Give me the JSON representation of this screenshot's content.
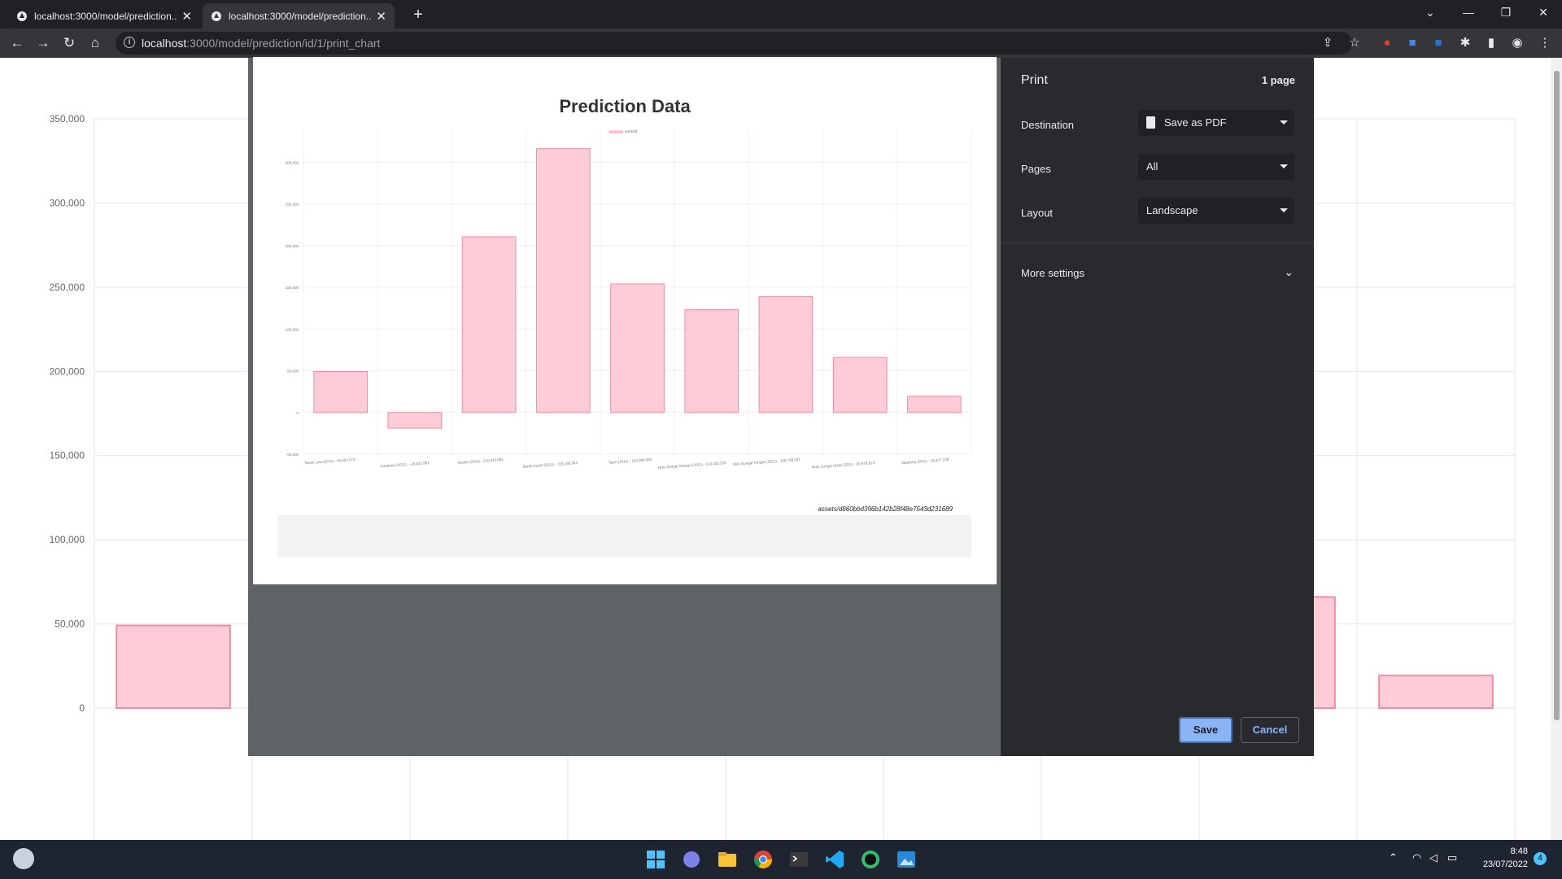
{
  "browser": {
    "tabs": [
      {
        "title": "localhost:3000/model/prediction..."
      },
      {
        "title": "localhost:3000/model/prediction..."
      }
    ],
    "new_tab_label": "+",
    "url_host": "localhost",
    "url_path": ":3000/model/prediction/id/1/print_chart"
  },
  "background_chart": {
    "y_ticks": [
      "350,000",
      "300,000",
      "250,000",
      "200,000",
      "150,000",
      "100,000",
      "50,000",
      "0"
    ]
  },
  "print_preview": {
    "title": "Prediction Data",
    "legend_label": "Result",
    "hash_text": "assets/d860bbd396b142b28f48e7543d231689"
  },
  "chart_data": {
    "type": "bar",
    "title": "Prediction Data",
    "categories": [
      "Tanah Laut (2011) - 49,053.074",
      "Kotabaru (2011) - -18,822.801",
      "Banjar (2011) - 210,613.891",
      "Barito Kuala (2011) - 316,158.844",
      "Tapin (2011) - 154,006.984",
      "Hulu Sungai Selatan (2011) - 123,253.523",
      "Hulu Sungai Tengah (2011) - 138,758.531",
      "Hulu Sungai Utara (2011) - 65,978.914",
      "Tabalong (2011) - 19,427.238"
    ],
    "values": [
      49053.074,
      -18822.801,
      210613.891,
      316158.844,
      154006.984,
      123253.523,
      138758.531,
      65978.914,
      19427.238
    ],
    "series": [
      {
        "name": "Result"
      }
    ],
    "ylim": [
      -50000,
      350000
    ],
    "y_ticks": [
      "350,000",
      "300,000",
      "250,000",
      "200,000",
      "150,000",
      "100,000",
      "50,000",
      "0",
      "-50,000"
    ],
    "legend": "top",
    "grid": true,
    "color": "#ffcdd8",
    "border_color": "#f28ba6"
  },
  "print_panel": {
    "title": "Print",
    "page_count": "1 page",
    "destination_label": "Destination",
    "destination_value": "Save as PDF",
    "pages_label": "Pages",
    "pages_value": "All",
    "layout_label": "Layout",
    "layout_value": "Landscape",
    "more_settings": "More settings",
    "save": "Save",
    "cancel": "Cancel"
  },
  "taskbar": {
    "time": "8:48",
    "date": "23/07/2022",
    "notifications": "4"
  }
}
